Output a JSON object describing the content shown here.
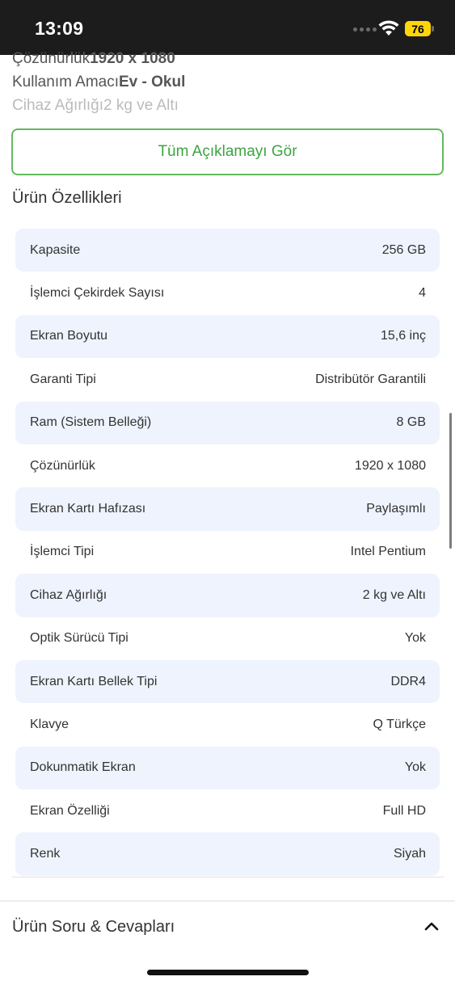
{
  "status_bar": {
    "time": "13:09",
    "battery": "76"
  },
  "description": {
    "lines": [
      {
        "label": "Çözünürlük",
        "value": "1920 x 1080"
      },
      {
        "label": "Kullanım Amacı",
        "value": "Ev - Okul"
      },
      {
        "label": "Cihaz Ağırlığı",
        "value": "2 kg ve Altı"
      }
    ]
  },
  "see_all_button": "Tüm Açıklamayı Gör",
  "section_title": "Ürün Özellikleri",
  "specs": [
    {
      "name": "Kapasite",
      "value": "256 GB"
    },
    {
      "name": "İşlemci Çekirdek Sayısı",
      "value": "4"
    },
    {
      "name": "Ekran Boyutu",
      "value": "15,6 inç"
    },
    {
      "name": "Garanti Tipi",
      "value": "Distribütör Garantili"
    },
    {
      "name": "Ram (Sistem Belleği)",
      "value": "8 GB"
    },
    {
      "name": "Çözünürlük",
      "value": "1920 x 1080"
    },
    {
      "name": "Ekran Kartı Hafızası",
      "value": "Paylaşımlı"
    },
    {
      "name": "İşlemci Tipi",
      "value": "Intel Pentium"
    },
    {
      "name": "Cihaz Ağırlığı",
      "value": "2 kg ve Altı"
    },
    {
      "name": "Optik Sürücü Tipi",
      "value": "Yok"
    },
    {
      "name": "Ekran Kartı Bellek Tipi",
      "value": "DDR4"
    },
    {
      "name": "Klavye",
      "value": "Q Türkçe"
    },
    {
      "name": "Dokunmatik Ekran",
      "value": "Yok"
    },
    {
      "name": "Ekran Özelliği",
      "value": "Full HD"
    },
    {
      "name": "Renk",
      "value": "Siyah"
    }
  ],
  "qa_section": {
    "title": "Ürün Soru & Cevapları",
    "icon": "chevron-up-icon"
  },
  "colors": {
    "accent_green": "#3aa63f",
    "row_shade": "#eef3fd",
    "status_bar_bg": "#1c1c1c",
    "battery": "#ffd60a"
  }
}
